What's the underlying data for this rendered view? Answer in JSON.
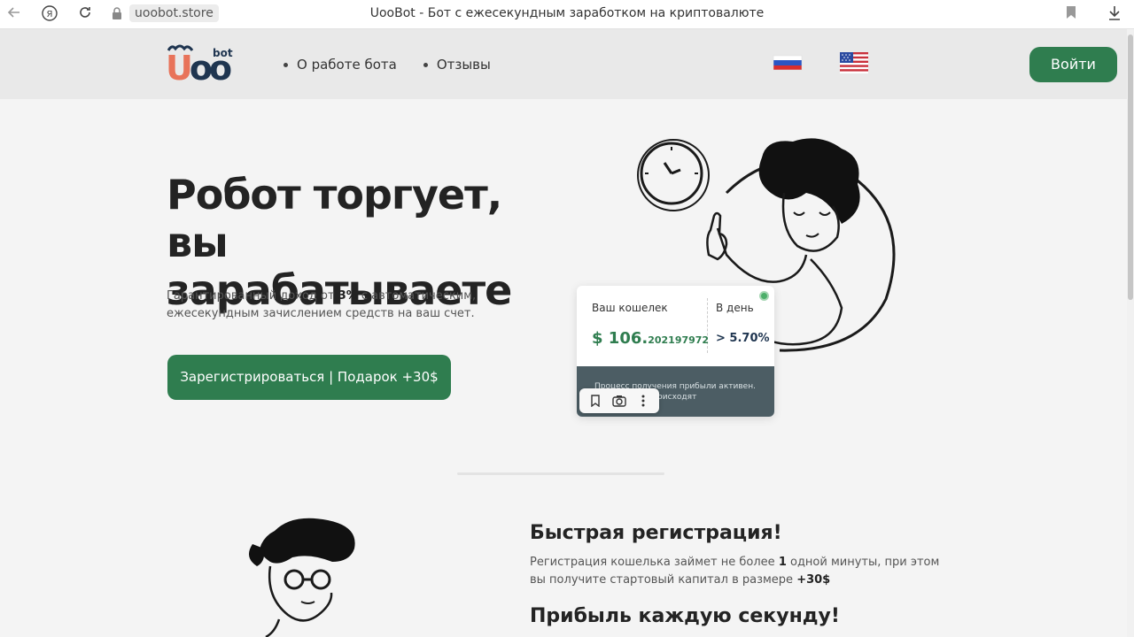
{
  "browser": {
    "url": "uoobot.store",
    "tab_title": "UooBot - Бот с ежесекундным заработком на криптовалюте",
    "icons": [
      "back-icon",
      "yandex-icon",
      "reload-icon",
      "lock-icon",
      "bookmark-icon",
      "download-icon"
    ]
  },
  "header": {
    "logo": {
      "u": "U",
      "oo": "oo",
      "bot": "bot"
    },
    "menu": [
      {
        "label": "О работе бота"
      },
      {
        "label": "Отзывы"
      }
    ],
    "languages": [
      "ru-flag-icon",
      "us-flag-icon"
    ],
    "login_label": "Войти"
  },
  "hero": {
    "title": "Робот торгует, вы зарабатываете",
    "subtitle_pre": "Гарантированный доход от ",
    "subtitle_bold": "3%",
    "subtitle_post": " с автоматическим, ежесекундным зачислением средств на ваш счет.",
    "cta_label": "Зарегистрироваться | Подарок +30$"
  },
  "wallet": {
    "label": "Ваш кошелек",
    "day_label": "В день",
    "amount_main": "$ 106.",
    "amount_fraction": "202197972",
    "rate": "> 5.70%",
    "footer_line1": "Процесс получения прибыли активен.",
    "footer_line2": "Начисления происходят ежесекундно."
  },
  "features": {
    "title_1": "Быстрая регистрация!",
    "text_1_pre": "Регистрация кошелька займет не более ",
    "text_1_bold1": "1",
    "text_1_mid": " одной минуты, при этом вы получите стартовый капитал в размере ",
    "text_1_bold2": "+30$",
    "title_2": "Прибыль каждую секунду!"
  },
  "colors": {
    "accent_green": "#2f7d4f",
    "logo_orange": "#e8735a",
    "logo_navy": "#1f3550",
    "header_bg": "#e9e9e9"
  }
}
